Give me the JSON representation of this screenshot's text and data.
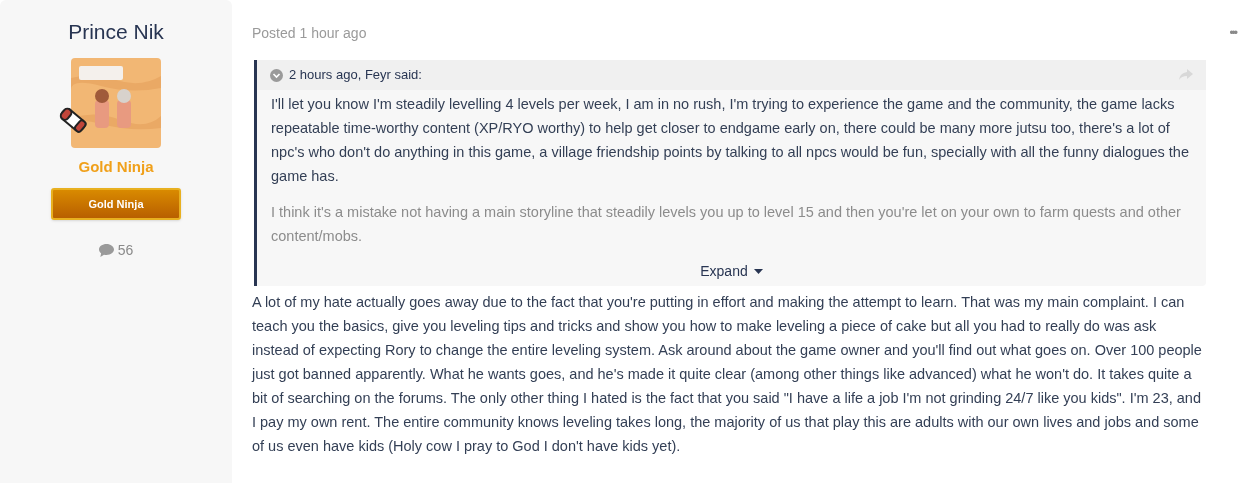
{
  "author": {
    "name": "Prince Nik",
    "rank": "Gold Ninja",
    "badge": "Gold Ninja",
    "post_count": "56"
  },
  "post": {
    "meta": "Posted 1 hour ago",
    "menu": "•••",
    "quote": {
      "citation": "2 hours ago, Feyr said:",
      "expanded": false,
      "paragraphs": [
        "I'll let you know I'm steadily levelling 4 levels per week, I am in no rush, I'm trying to experience the game and the community, the game lacks repeatable time-worthy content (XP/RYO worthy) to help get closer to endgame early on, there could be many more jutsu too, there's a lot of npc's who don't do anything in this game, a village friendship points by talking to all npcs would be fun, specially with all the funny dialogues the game has.",
        "I think it's a mistake not having a main storyline that steadily levels you up to level 15 and then you're let on your own to farm quests and other content/mobs."
      ],
      "expand_label": "Expand"
    },
    "body": "A lot of my hate actually goes away due to the fact that you're putting in effort and making the attempt to learn. That was my main complaint. I can teach you the basics, give you leveling tips and tricks and show you how to make leveling a piece of cake but all you had to really do was ask instead of expecting Rory to change the entire leveling system. Ask around about the game owner and you'll find out what goes on. Over 100 people just got banned apparently. What he wants goes, and he's made it quite clear (among other things like advanced) what he won't do. It takes quite a bit of searching on the forums. The only other thing I hated is the fact that you said \"I have a life a job I'm not grinding 24/7 like you kids\". I'm 23, and I pay my own rent. The entire community knows leveling takes long, the majority of us that play this are adults with our own lives and jobs and some of us even have kids (Holy cow I pray to God I don't have kids yet)."
  }
}
